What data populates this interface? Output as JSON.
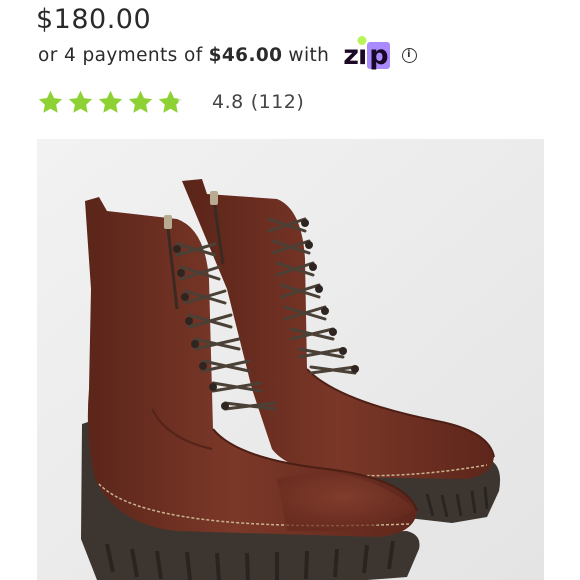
{
  "product": {
    "price": "$180.00",
    "image_icon": "boot-image",
    "image_colors": {
      "leather": "#6e2f22",
      "sole": "#3d3630",
      "background": "#eeeeee"
    }
  },
  "installments": {
    "prefix": "or 4 payments of",
    "amount": "$46.00",
    "suffix": "with",
    "provider_logo": "zip-logo",
    "provider_logo_text": "zip",
    "info_icon": "info-icon",
    "colors": {
      "logo_text": "#1a0826",
      "logo_dot": "#b9f45a",
      "logo_p_bg": "#a98bff"
    }
  },
  "rating": {
    "stars": 4.8,
    "max_stars": 5,
    "star_color": "#8ed134",
    "score": "4.8",
    "count": "(112)"
  }
}
